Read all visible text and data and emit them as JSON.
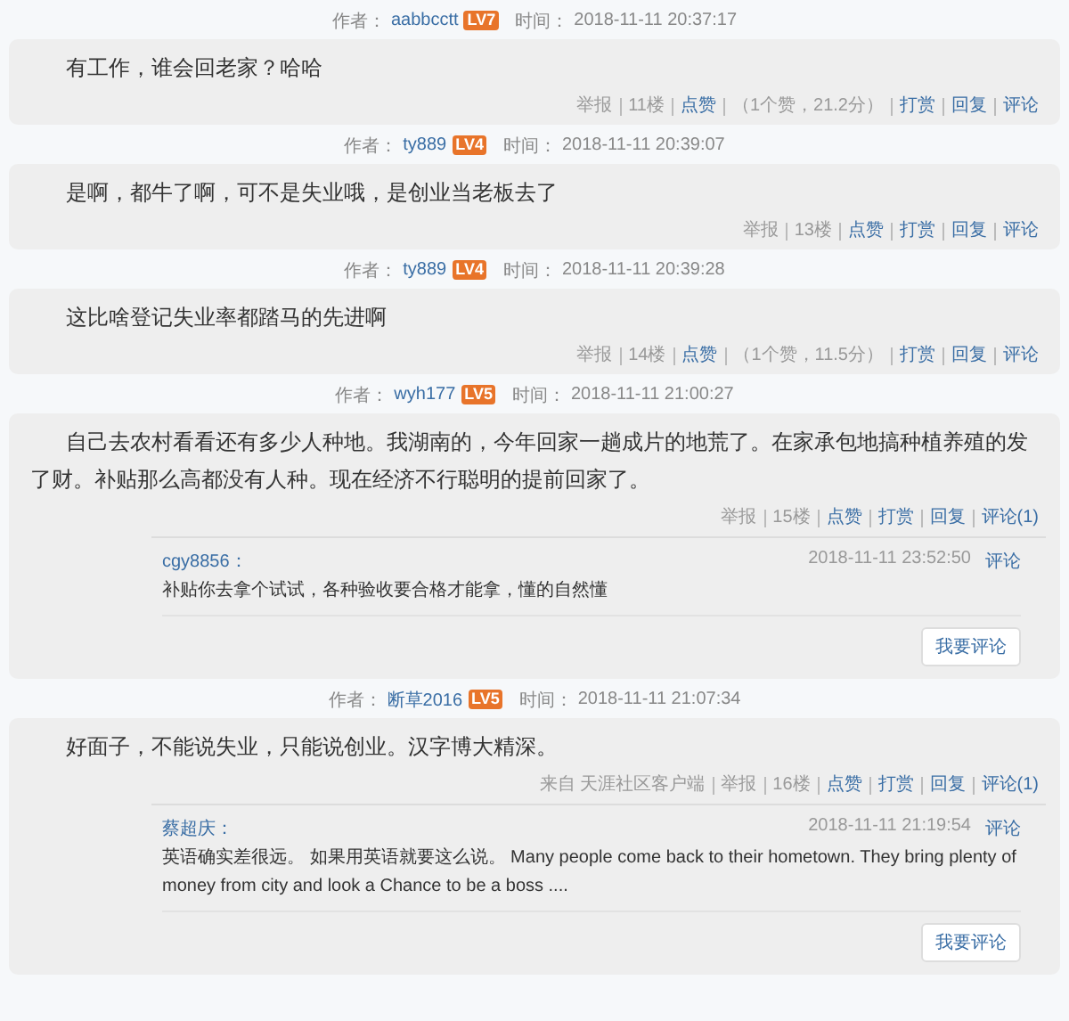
{
  "posts": [
    {
      "author_label": "作者：",
      "author": "aabbcctt",
      "level": "LV7",
      "time_label": "时间：",
      "time": "2018-11-11 20:37:17",
      "body": "有工作，谁会回老家？哈哈",
      "actions": [
        {
          "kind": "plain",
          "text": "举报"
        },
        {
          "kind": "plain",
          "text": "11楼"
        },
        {
          "kind": "link",
          "text": "点赞"
        },
        {
          "kind": "plain",
          "text": "（1个赞，21.2分）"
        },
        {
          "kind": "link",
          "text": "打赏"
        },
        {
          "kind": "link",
          "text": "回复"
        },
        {
          "kind": "link",
          "text": "评论"
        }
      ]
    },
    {
      "author_label": "作者：",
      "author": "ty889",
      "level": "LV4",
      "time_label": "时间：",
      "time": "2018-11-11 20:39:07",
      "body": "是啊，都牛了啊，可不是失业哦，是创业当老板去了",
      "actions": [
        {
          "kind": "plain",
          "text": "举报"
        },
        {
          "kind": "plain",
          "text": "13楼"
        },
        {
          "kind": "link",
          "text": "点赞"
        },
        {
          "kind": "link",
          "text": "打赏"
        },
        {
          "kind": "link",
          "text": "回复"
        },
        {
          "kind": "link",
          "text": "评论"
        }
      ]
    },
    {
      "author_label": "作者：",
      "author": "ty889",
      "level": "LV4",
      "time_label": "时间：",
      "time": "2018-11-11 20:39:28",
      "body": "这比啥登记失业率都踏马的先进啊",
      "actions": [
        {
          "kind": "plain",
          "text": "举报"
        },
        {
          "kind": "plain",
          "text": "14楼"
        },
        {
          "kind": "link",
          "text": "点赞"
        },
        {
          "kind": "plain",
          "text": "（1个赞，11.5分）"
        },
        {
          "kind": "link",
          "text": "打赏"
        },
        {
          "kind": "link",
          "text": "回复"
        },
        {
          "kind": "link",
          "text": "评论"
        }
      ]
    },
    {
      "author_label": "作者：",
      "author": "wyh177",
      "level": "LV5",
      "time_label": "时间：",
      "time": "2018-11-11 21:00:27",
      "body": "自己去农村看看还有多少人种地。我湖南的，今年回家一趟成片的地荒了。在家承包地搞种植养殖的发了财。补贴那么高都没有人种。现在经济不行聪明的提前回家了。",
      "actions": [
        {
          "kind": "plain",
          "text": "举报"
        },
        {
          "kind": "plain",
          "text": "15楼"
        },
        {
          "kind": "link",
          "text": "点赞"
        },
        {
          "kind": "link",
          "text": "打赏"
        },
        {
          "kind": "link",
          "text": "回复"
        },
        {
          "kind": "link",
          "text": "评论(1)"
        }
      ],
      "comments": [
        {
          "author": "cgy8856：",
          "time": "2018-11-11 23:52:50",
          "action": "评论",
          "text": "补贴你去拿个试试，各种验收要合格才能拿，懂的自然懂"
        }
      ],
      "comment_button": "我要评论"
    },
    {
      "author_label": "作者：",
      "author": "断草2016",
      "level": "LV5",
      "time_label": "时间：",
      "time": "2018-11-11 21:07:34",
      "body": "好面子，不能说失业，只能说创业。汉字博大精深。",
      "actions": [
        {
          "kind": "plain",
          "text": "来自 天涯社区客户端"
        },
        {
          "kind": "plain",
          "text": "举报"
        },
        {
          "kind": "plain",
          "text": "16楼"
        },
        {
          "kind": "link",
          "text": "点赞"
        },
        {
          "kind": "link",
          "text": "打赏"
        },
        {
          "kind": "link",
          "text": "回复"
        },
        {
          "kind": "link",
          "text": "评论(1)"
        }
      ],
      "comments": [
        {
          "author": "蔡超庆：",
          "time": "2018-11-11 21:19:54",
          "action": "评论",
          "text": "英语确实差很远。 如果用英语就要这么说。 Many people come back to their hometown. They bring plenty of money from city and look a Chance to be a boss ...."
        }
      ],
      "comment_button": "我要评论"
    }
  ]
}
